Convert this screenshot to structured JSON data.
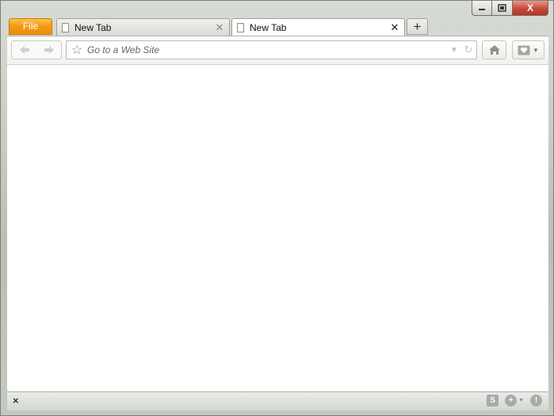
{
  "titlebar": {
    "minimize_label": "▁",
    "maximize_label": "▣",
    "close_label": "X"
  },
  "file_menu": {
    "label": "File"
  },
  "tabs": [
    {
      "label": "New Tab",
      "active": false
    },
    {
      "label": "New Tab",
      "active": true
    }
  ],
  "new_tab": {
    "label": "+"
  },
  "toolbar": {
    "back_icon": "back-arrow-icon",
    "forward_icon": "forward-arrow-icon",
    "home_icon": "home-icon",
    "favorites_icon": "favorites-menu-icon"
  },
  "address_bar": {
    "placeholder": "Go to a Web Site",
    "value": ""
  },
  "status_bar": {
    "close_label": "×",
    "icons": [
      "skype-icon",
      "add-on-icon",
      "alert-icon"
    ]
  },
  "colors": {
    "file_button": "#f29a14",
    "close_button": "#c5493a",
    "frame": "#c9cec6"
  }
}
